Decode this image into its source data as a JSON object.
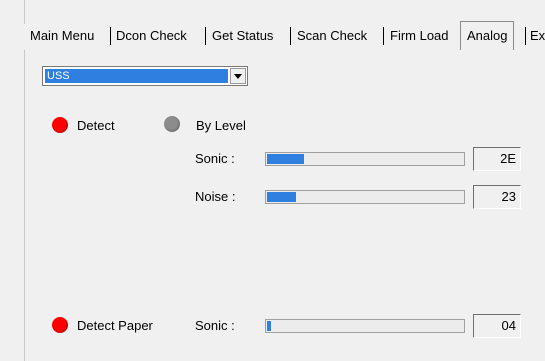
{
  "tabs": [
    {
      "label": "Main Menu"
    },
    {
      "label": "Dcon Check"
    },
    {
      "label": "Get Status"
    },
    {
      "label": "Scan Check"
    },
    {
      "label": "Firm Load"
    },
    {
      "label": "Analog",
      "active": true
    },
    {
      "label": "Ex"
    }
  ],
  "sensor_select": {
    "value": "USS"
  },
  "detect": {
    "label": "Detect",
    "indicator_color": "#ff0000"
  },
  "by_level": {
    "label": "By Level",
    "indicator_color": "#8c8c8c"
  },
  "levels": [
    {
      "label": "Sonic :",
      "value": "2E",
      "fill_fraction": 0.19
    },
    {
      "label": "Noise :",
      "value": "23",
      "fill_fraction": 0.15
    }
  ],
  "detect_paper": {
    "label": "Detect Paper",
    "indicator_color": "#ff0000",
    "sonic_label": "Sonic :",
    "value": "04",
    "fill_fraction": 0.02
  },
  "accent_color": "#2f7fe0"
}
